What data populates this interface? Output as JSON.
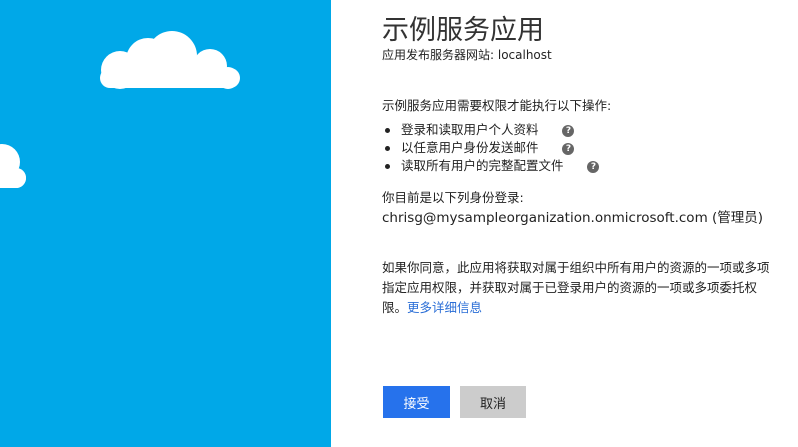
{
  "app": {
    "title": "示例服务应用",
    "subtitle": "应用发布服务器网站: localhost"
  },
  "permissions": {
    "intro": "示例服务应用需要权限才能执行以下操作:",
    "items": [
      {
        "label": "登录和读取用户个人资料",
        "help_icon": "question-circle-icon"
      },
      {
        "label": "以任意用户身份发送邮件",
        "help_icon": "question-circle-icon"
      },
      {
        "label": "读取所有用户的完整配置文件",
        "help_icon": "question-circle-icon"
      }
    ],
    "help_glyph": "?"
  },
  "account": {
    "label": "你目前是以下列身份登录:",
    "user": "chrisg@mysampleorganization.onmicrosoft.com (管理员)"
  },
  "consent": {
    "text": "如果你同意，此应用将获取对属于组织中所有用户的资源的一项或多项指定应用权限，并获取对属于已登录用户的资源的一项或多项委托权限。",
    "link": "更多详细信息"
  },
  "buttons": {
    "accept": "接受",
    "cancel": "取消"
  },
  "colors": {
    "panel": "#00a8e8",
    "accept": "#2672ec",
    "cancel": "#cccccc",
    "link": "#2a6ed6"
  }
}
